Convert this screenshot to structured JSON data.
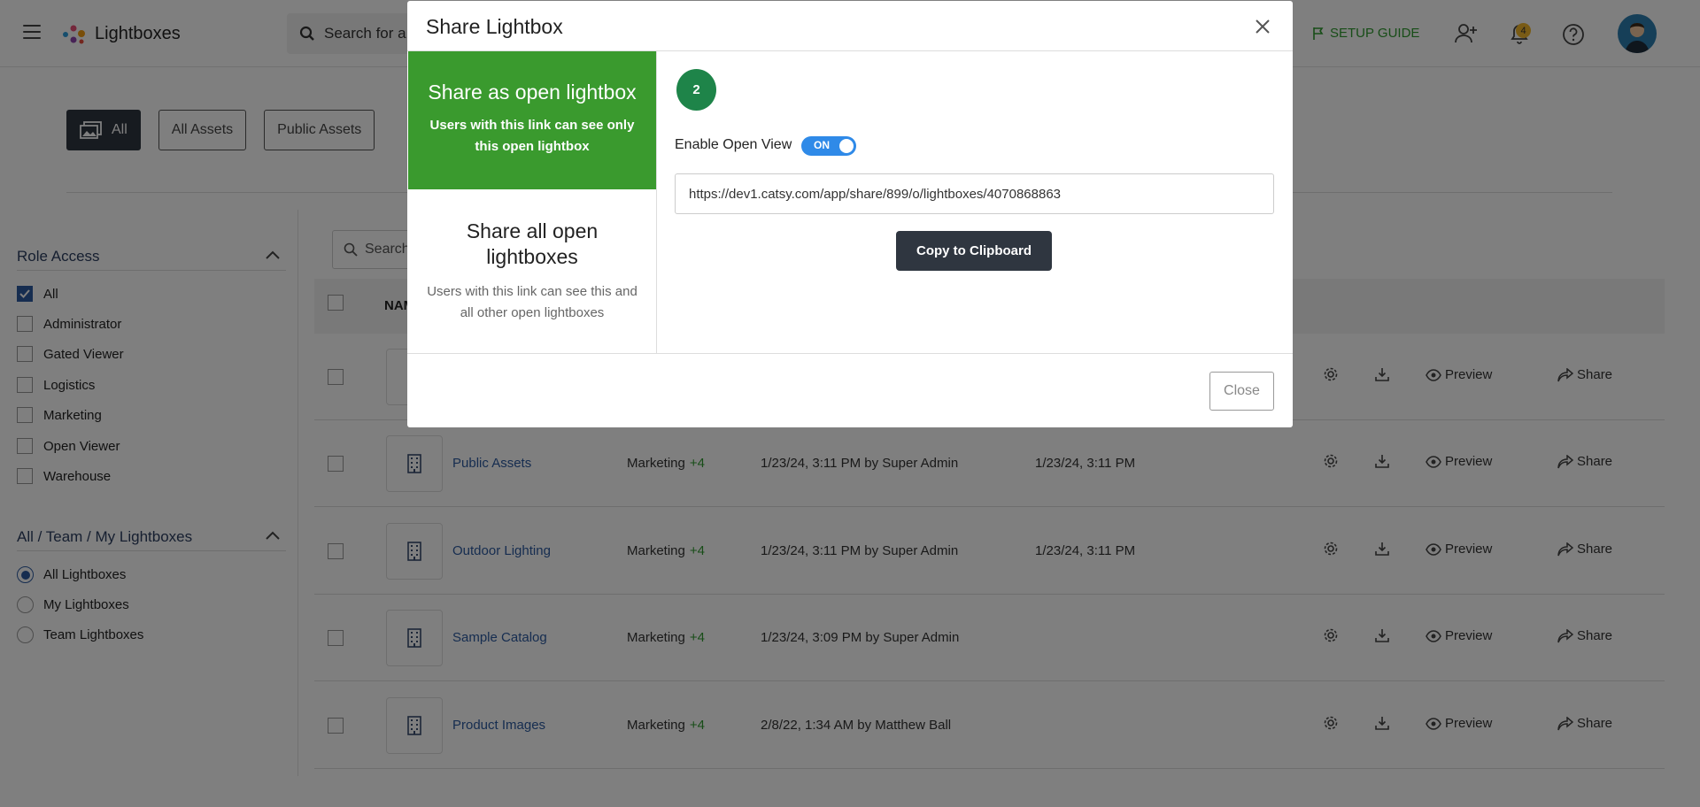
{
  "app": {
    "title": "Lightboxes",
    "search_placeholder": "Search for a",
    "setup_guide": "SETUP GUIDE",
    "notification_count": "4"
  },
  "chips": [
    "All",
    "All Assets",
    "Public Assets"
  ],
  "filters": {
    "role_access": {
      "title": "Role Access",
      "options": [
        "All",
        "Administrator",
        "Gated Viewer",
        "Logistics",
        "Marketing",
        "Open Viewer",
        "Warehouse"
      ],
      "checked": "All"
    },
    "ownership": {
      "title": "All / Team / My Lightboxes",
      "options": [
        "All Lightboxes",
        "My Lightboxes",
        "Team Lightboxes"
      ],
      "selected": "All Lightboxes"
    }
  },
  "table": {
    "search_placeholder": "Search",
    "name_header": "NAM",
    "actions": {
      "preview": "Preview",
      "share": "Share"
    },
    "rows": [
      {
        "name": "",
        "role": "",
        "plus": "",
        "created": "",
        "modified": ""
      },
      {
        "name": "Public Assets",
        "role": "Marketing",
        "plus": "+4",
        "created": "1/23/24, 3:11 PM by Super Admin",
        "modified": "1/23/24, 3:11 PM"
      },
      {
        "name": "Outdoor Lighting",
        "role": "Marketing",
        "plus": "+4",
        "created": "1/23/24, 3:11 PM by Super Admin",
        "modified": "1/23/24, 3:11 PM"
      },
      {
        "name": "Sample Catalog",
        "role": "Marketing",
        "plus": "+4",
        "created": "1/23/24, 3:09 PM by Super Admin",
        "modified": ""
      },
      {
        "name": "Product Images",
        "role": "Marketing",
        "plus": "+4",
        "created": "2/8/22, 1:34 AM by Matthew Ball",
        "modified": ""
      }
    ]
  },
  "modal": {
    "title": "Share Lightbox",
    "option_open": {
      "title": "Share as open lightbox",
      "desc": "Users with this link can see only this open lightbox"
    },
    "option_all": {
      "title": "Share all open lightboxes",
      "desc": "Users with this link can see this and all other open lightboxes"
    },
    "step": "2",
    "enable_label": "Enable Open View",
    "toggle_state": "ON",
    "share_url": "https://dev1.catsy.com/app/share/899/o/lightboxes/4070868863",
    "copy_button": "Copy to Clipboard",
    "close_button": "Close"
  },
  "colors": {
    "green": "#3a9a2e",
    "step_green": "#1e8449",
    "dark": "#2f3640",
    "link": "#2c5aa0",
    "toggle": "#2f8ae8"
  },
  "icons": [
    "hamburger-icon",
    "search-icon",
    "flag-icon",
    "add-user-icon",
    "bell-icon",
    "help-icon",
    "gear-icon",
    "download-icon",
    "eye-icon",
    "share-icon",
    "building-icon",
    "close-icon",
    "chevron-up-icon"
  ]
}
